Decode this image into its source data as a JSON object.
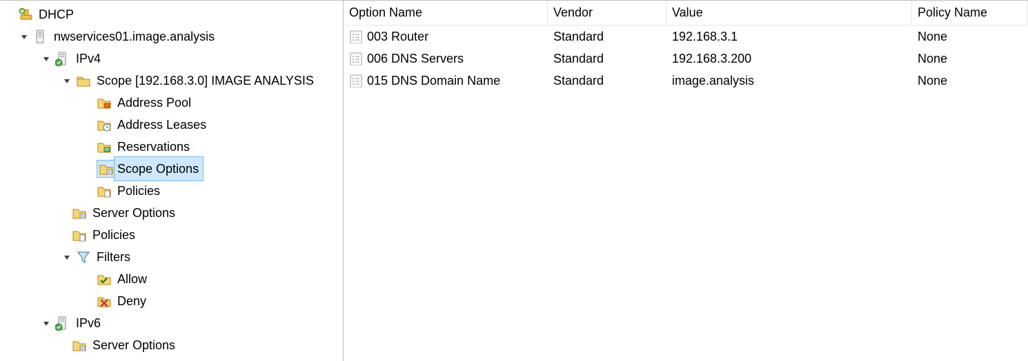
{
  "tree": {
    "root_label": "DHCP",
    "server_label": "nwservices01.image.analysis",
    "ipv4_label": "IPv4",
    "scope_label": "Scope [192.168.3.0] IMAGE ANALYSIS",
    "address_pool_label": "Address Pool",
    "address_leases_label": "Address Leases",
    "reservations_label": "Reservations",
    "scope_options_label": "Scope Options",
    "scope_policies_label": "Policies",
    "server_options_label": "Server Options",
    "server_policies_label": "Policies",
    "filters_label": "Filters",
    "filters_allow_label": "Allow",
    "filters_deny_label": "Deny",
    "ipv6_label": "IPv6",
    "ipv6_server_options_label": "Server Options"
  },
  "list": {
    "headers": {
      "option_name": "Option Name",
      "vendor": "Vendor",
      "value": "Value",
      "policy_name": "Policy Name"
    },
    "rows": [
      {
        "option_name": "003 Router",
        "vendor": "Standard",
        "value": "192.168.3.1",
        "policy_name": "None"
      },
      {
        "option_name": "006 DNS Servers",
        "vendor": "Standard",
        "value": "192.168.3.200",
        "policy_name": "None"
      },
      {
        "option_name": "015 DNS Domain Name",
        "vendor": "Standard",
        "value": "image.analysis",
        "policy_name": "None"
      }
    ]
  }
}
